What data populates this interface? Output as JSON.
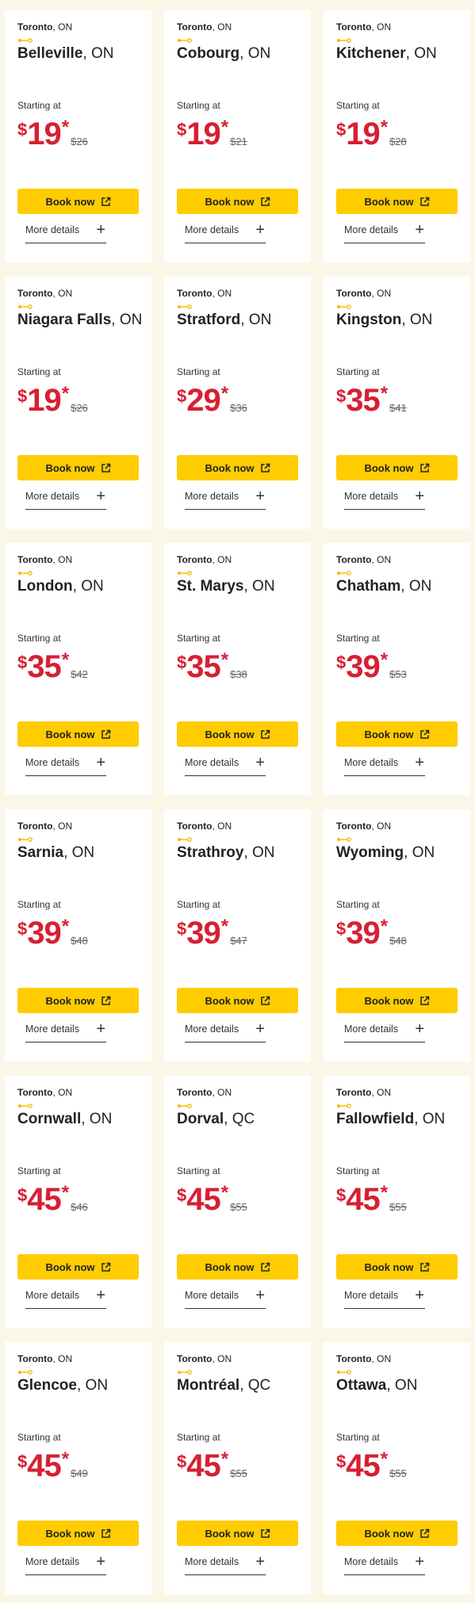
{
  "labels": {
    "starting_at": "Starting at",
    "book_now": "Book now",
    "more_details": "More details",
    "currency": "$",
    "asterisk": "*"
  },
  "colors": {
    "background": "#fbf7e8",
    "price": "#d71f33",
    "button": "#ffcc00",
    "route_icon": "#f5b800"
  },
  "cards": [
    {
      "origin_city": "Toronto",
      "origin_prov": ", ON",
      "dest_city": "Belleville",
      "dest_prov": ", ON",
      "price": "19",
      "old_price": "$26"
    },
    {
      "origin_city": "Toronto",
      "origin_prov": ", ON",
      "dest_city": "Cobourg",
      "dest_prov": ", ON",
      "price": "19",
      "old_price": "$21"
    },
    {
      "origin_city": "Toronto",
      "origin_prov": ", ON",
      "dest_city": "Kitchener",
      "dest_prov": ", ON",
      "price": "19",
      "old_price": "$28"
    },
    {
      "origin_city": "Toronto",
      "origin_prov": ", ON",
      "dest_city": "Niagara Falls",
      "dest_prov": ", ON",
      "price": "19",
      "old_price": "$26"
    },
    {
      "origin_city": "Toronto",
      "origin_prov": ", ON",
      "dest_city": "Stratford",
      "dest_prov": ", ON",
      "price": "29",
      "old_price": "$36"
    },
    {
      "origin_city": "Toronto",
      "origin_prov": ", ON",
      "dest_city": "Kingston",
      "dest_prov": ", ON",
      "price": "35",
      "old_price": "$41"
    },
    {
      "origin_city": "Toronto",
      "origin_prov": ", ON",
      "dest_city": "London",
      "dest_prov": ", ON",
      "price": "35",
      "old_price": "$42"
    },
    {
      "origin_city": "Toronto",
      "origin_prov": ", ON",
      "dest_city": "St. Marys",
      "dest_prov": ", ON",
      "price": "35",
      "old_price": "$38"
    },
    {
      "origin_city": "Toronto",
      "origin_prov": ", ON",
      "dest_city": "Chatham",
      "dest_prov": ", ON",
      "price": "39",
      "old_price": "$53"
    },
    {
      "origin_city": "Toronto",
      "origin_prov": ", ON",
      "dest_city": "Sarnia",
      "dest_prov": ", ON",
      "price": "39",
      "old_price": "$48"
    },
    {
      "origin_city": "Toronto",
      "origin_prov": ", ON",
      "dest_city": "Strathroy",
      "dest_prov": ", ON",
      "price": "39",
      "old_price": "$47"
    },
    {
      "origin_city": "Toronto",
      "origin_prov": ", ON",
      "dest_city": "Wyoming",
      "dest_prov": ", ON",
      "price": "39",
      "old_price": "$48"
    },
    {
      "origin_city": "Toronto",
      "origin_prov": ", ON",
      "dest_city": "Cornwall",
      "dest_prov": ", ON",
      "price": "45",
      "old_price": "$46"
    },
    {
      "origin_city": "Toronto",
      "origin_prov": ", ON",
      "dest_city": "Dorval",
      "dest_prov": ", QC",
      "price": "45",
      "old_price": "$55"
    },
    {
      "origin_city": "Toronto",
      "origin_prov": ", ON",
      "dest_city": "Fallowfield",
      "dest_prov": ", ON",
      "price": "45",
      "old_price": "$55"
    },
    {
      "origin_city": "Toronto",
      "origin_prov": ", ON",
      "dest_city": "Glencoe",
      "dest_prov": ", ON",
      "price": "45",
      "old_price": "$49"
    },
    {
      "origin_city": "Toronto",
      "origin_prov": ", ON",
      "dest_city": "Montréal",
      "dest_prov": ", QC",
      "price": "45",
      "old_price": "$55"
    },
    {
      "origin_city": "Toronto",
      "origin_prov": ", ON",
      "dest_city": "Ottawa",
      "dest_prov": ", ON",
      "price": "45",
      "old_price": "$55"
    }
  ]
}
